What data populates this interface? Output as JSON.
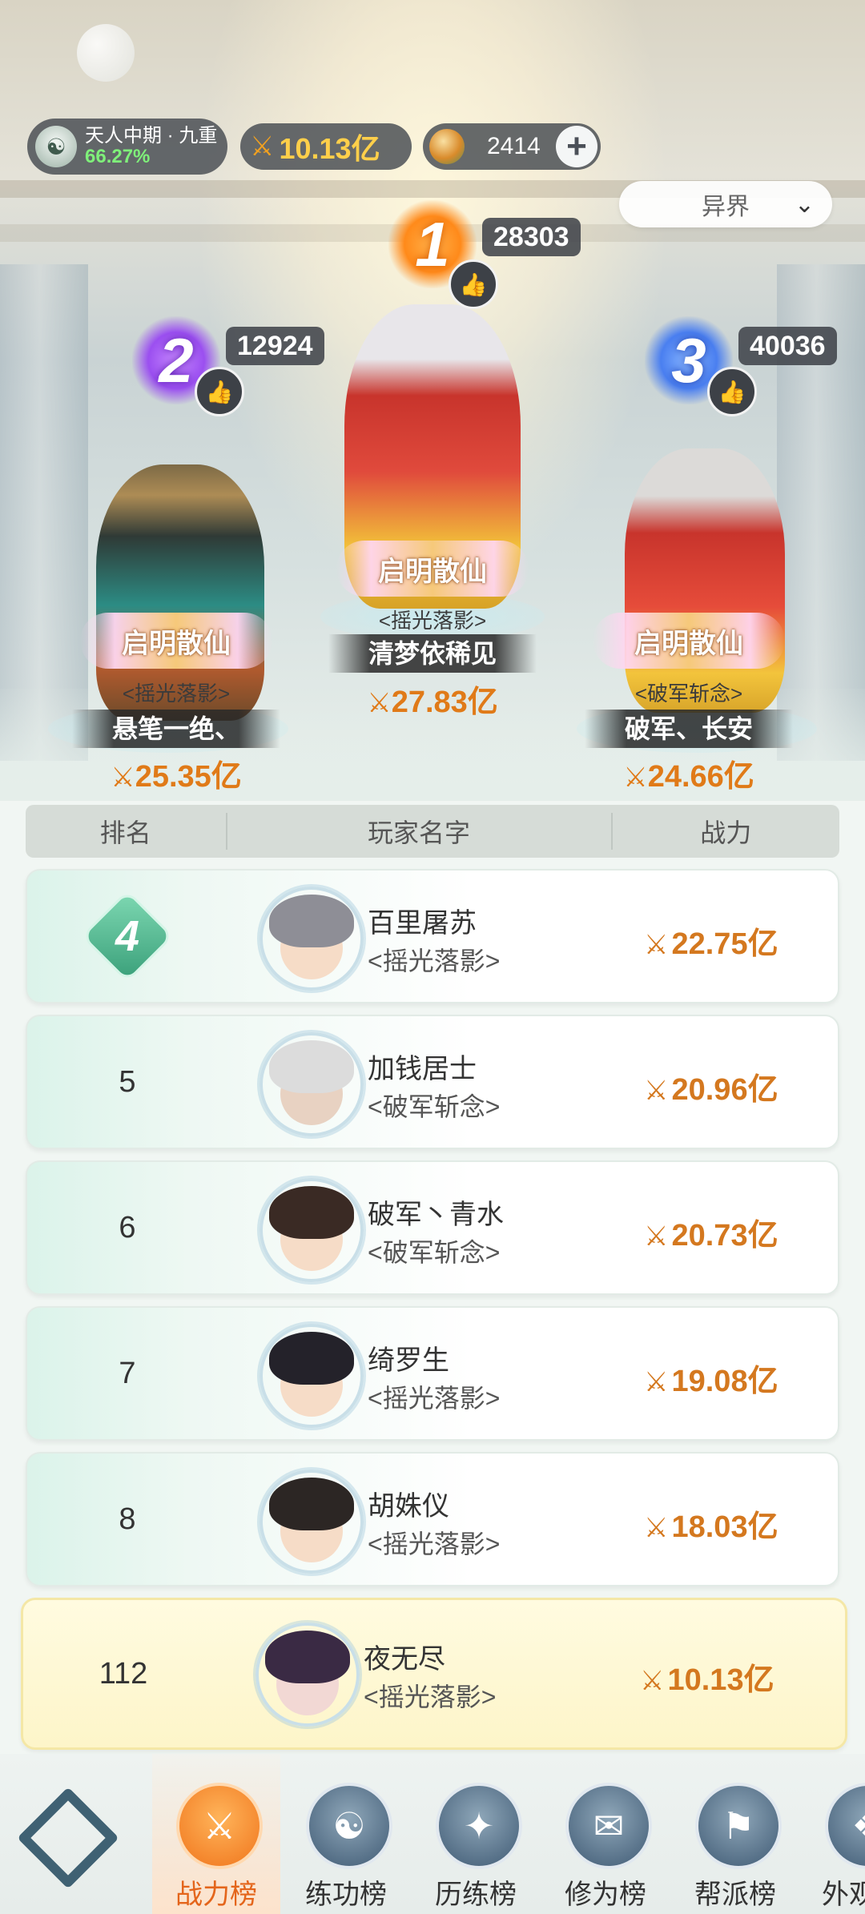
{
  "header": {
    "realm": "天人中期 · 九重",
    "realm_progress": "66.27%",
    "power": "10.13亿",
    "jade": "2414",
    "plus": "+",
    "server_select": "异界"
  },
  "podium": [
    {
      "rank": "1",
      "likes": "28303",
      "title": "启明散仙",
      "sect": "<摇光落影>",
      "name": "清梦依稀见",
      "power": "27.83亿"
    },
    {
      "rank": "2",
      "likes": "12924",
      "title": "启明散仙",
      "sect": "<摇光落影>",
      "name": "悬笔一绝、",
      "power": "25.35亿"
    },
    {
      "rank": "3",
      "likes": "40036",
      "title": "启明散仙",
      "sect": "<破军斩念>",
      "name": "破军、长安",
      "power": "24.66亿"
    }
  ],
  "table": {
    "headers": [
      "排名",
      "玩家名字",
      "战力"
    ],
    "rows": [
      {
        "rank": "4",
        "name": "百里屠苏",
        "sect": "<摇光落影>",
        "power": "22.75亿"
      },
      {
        "rank": "5",
        "name": "加钱居士",
        "sect": "<破军斩念>",
        "power": "20.96亿"
      },
      {
        "rank": "6",
        "name": "破军丶青水",
        "sect": "<破军斩念>",
        "power": "20.73亿"
      },
      {
        "rank": "7",
        "name": "绮罗生",
        "sect": "<摇光落影>",
        "power": "19.08亿"
      },
      {
        "rank": "8",
        "name": "胡姝仪",
        "sect": "<摇光落影>",
        "power": "18.03亿"
      }
    ],
    "me": {
      "rank": "112",
      "name": "夜无尽",
      "sect": "<摇光落影>",
      "power": "10.13亿"
    }
  },
  "nav": {
    "items": [
      "战力榜",
      "练功榜",
      "历练榜",
      "修为榜",
      "帮派榜",
      "外观"
    ],
    "active": "战力榜"
  },
  "colors": {
    "power": "#d4781f",
    "active_tab": "#e4651b",
    "gold": "#ffcf4a"
  },
  "icons": [
    "sword-power-icon",
    "jade-currency-icon",
    "thumbs-up-icon",
    "chevron-down-icon",
    "plus-icon"
  ]
}
